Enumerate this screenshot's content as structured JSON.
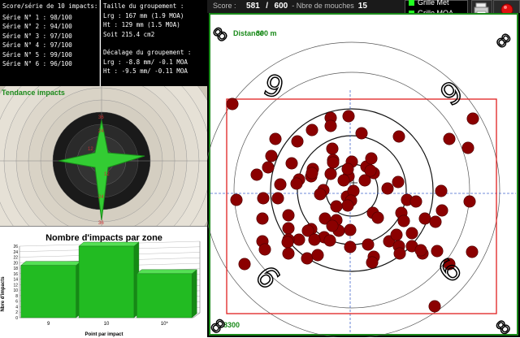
{
  "score_panel": {
    "heading": "Score/série de 10 impacts:",
    "series": [
      {
        "label": "Série N° 1 :",
        "value": "98/100"
      },
      {
        "label": "Série N° 2 :",
        "value": "94/100"
      },
      {
        "label": "Série N° 3 :",
        "value": "97/100"
      },
      {
        "label": "Série N° 4 :",
        "value": "97/100"
      },
      {
        "label": "Série N° 5 :",
        "value": "99/100"
      },
      {
        "label": "Série N° 6 :",
        "value": "96/100"
      }
    ]
  },
  "group_panel": {
    "heading": "Taille du groupement :",
    "width": "Lrg : 167 mm (1.9 MOA)",
    "height": "Ht : 129 mm (1.5 MOA)",
    "area": "Soit 215.4 cm2",
    "offset_heading": "Décalage du groupement :",
    "offset_width": "Lrg : -8.8 mm/ -0.1 MOA",
    "offset_height": "Ht : -9.5 mm/ -0.11 MOA"
  },
  "trend": {
    "title": "Tendance impacts",
    "ring_labels": [
      "36",
      "24",
      "12",
      "12",
      "24",
      "36"
    ]
  },
  "zone_chart": {
    "title": "Nombre d'impacts par zone",
    "ylabel": "Nbre d'impacts",
    "xlabel": "Point par impact",
    "yticks": [
      "0",
      "2",
      "4",
      "6",
      "8",
      "10",
      "12",
      "14",
      "16",
      "18",
      "20",
      "22",
      "24",
      "26"
    ]
  },
  "chart_data": {
    "type": "bar",
    "title": "Nombre d'impacts par zone",
    "xlabel": "Point par impact",
    "ylabel": "Nbre d'impacts",
    "categories": [
      "9",
      "10",
      "10*"
    ],
    "values": [
      19,
      26,
      16
    ],
    "ylim": [
      0,
      26
    ],
    "color": "#22bb22"
  },
  "topbar": {
    "score_label": "Score :",
    "score_value": "581",
    "score_sep": "/",
    "score_max": "600",
    "flies_label": "- Nbre de mouches",
    "flies_value": "15",
    "grid_met": "Grille Met",
    "grid_moa": "Grille MOA"
  },
  "target": {
    "distance_label": "Distance",
    "distance_value": "300 m",
    "corner_label": "8300",
    "ring_numbers": [
      "9",
      "9",
      "9",
      "9",
      "8",
      "8",
      "8",
      "8"
    ],
    "impact_color": "#8b0000",
    "group_box_color": "#e02020"
  }
}
